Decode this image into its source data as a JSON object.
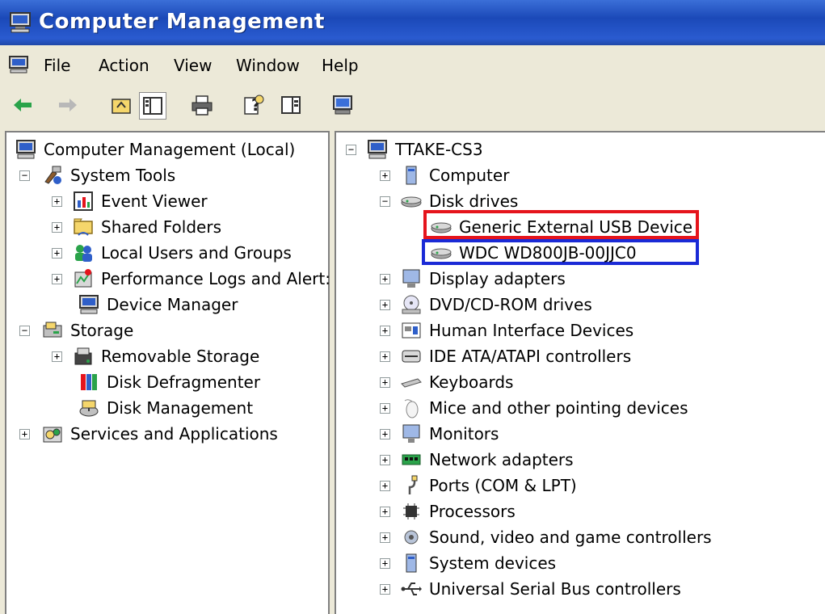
{
  "window": {
    "title": "Computer Management"
  },
  "menu": {
    "items": [
      "File",
      "Action",
      "View",
      "Window",
      "Help"
    ]
  },
  "toolbar": {
    "buttons": [
      "back-icon",
      "forward-icon",
      "up-folder-icon",
      "show-hide-tree-icon",
      "print-icon",
      "help-icon",
      "properties-icon",
      "device-icon"
    ]
  },
  "left_tree": {
    "root": "Computer Management (Local)",
    "system_tools": "System Tools",
    "event_viewer": "Event Viewer",
    "shared_folders": "Shared Folders",
    "local_users": "Local Users and Groups",
    "perf_logs": "Performance Logs and Alert:",
    "device_manager": "Device Manager",
    "storage": "Storage",
    "removable_storage": "Removable Storage",
    "disk_defrag": "Disk Defragmenter",
    "disk_management": "Disk Management",
    "services_apps": "Services and Applications"
  },
  "device_tree": {
    "root": "TTAKE-CS3",
    "computer": "Computer",
    "disk_drives": "Disk drives",
    "disk_children": [
      "Generic External USB Device",
      "WDC WD800JB-00JJC0"
    ],
    "categories": [
      "Display adapters",
      "DVD/CD-ROM drives",
      "Human Interface Devices",
      "IDE ATA/ATAPI controllers",
      "Keyboards",
      "Mice and other pointing devices",
      "Monitors",
      "Network adapters",
      "Ports (COM & LPT)",
      "Processors",
      "Sound, video and game controllers",
      "System devices",
      "Universal Serial Bus controllers"
    ]
  },
  "colors": {
    "title_bar": "#1b49b8",
    "highlight_red": "#e5141c",
    "highlight_blue": "#1a2ad6"
  }
}
